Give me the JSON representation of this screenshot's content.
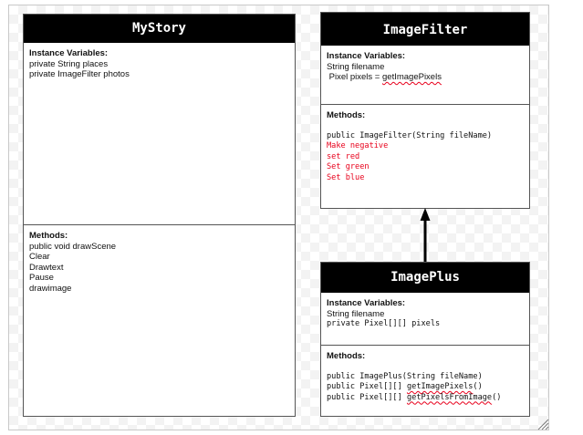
{
  "classes": {
    "mystory": {
      "name": "MyStory",
      "variables_title": "Instance Variables:",
      "variables": [
        "private String places",
        "private ImageFilter photos"
      ],
      "methods_title": "Methods:",
      "methods": [
        "public void drawScene",
        "Clear",
        "Drawtext",
        "Pause",
        "drawimage"
      ]
    },
    "imagefilter": {
      "name": "ImageFilter",
      "variables_title": "Instance Variables:",
      "variables": [
        "String filename",
        " Pixel pixels = ",
        "getImagePixels"
      ],
      "methods_title": "Methods:",
      "methods": [
        "public ImageFilter(String fileName)",
        "Make negative",
        "set red",
        "Set green",
        "Set blue"
      ]
    },
    "imageplus": {
      "name": "ImagePlus",
      "variables_title": "Instance Variables:",
      "variables": [
        "String filename",
        "private Pixel[][] pixels"
      ],
      "methods_title": "Methods:",
      "methods": [
        "public ImagePlus(String fileName)",
        "public Pixel[][] ",
        "getImagePixels",
        "()",
        "public Pixel[][] ",
        "getPixelsFromImage",
        "()"
      ]
    }
  },
  "relationship": {
    "from": "ImagePlus",
    "to": "ImageFilter",
    "type": "inheritance"
  },
  "colors": {
    "header_bg": "#000000",
    "header_text": "#ffffff",
    "highlight_text": "#e8001b",
    "border": "#555555"
  }
}
